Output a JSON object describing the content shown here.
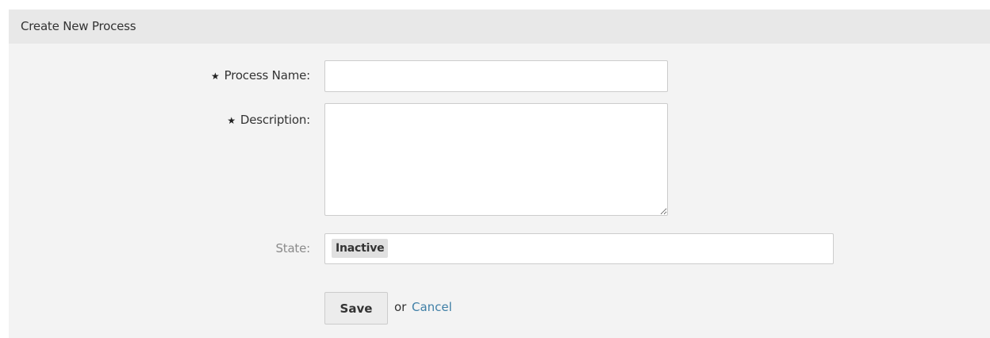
{
  "panel": {
    "title": "Create New Process"
  },
  "form": {
    "process_name": {
      "label": "Process Name:",
      "required_marker": "★",
      "value": ""
    },
    "description": {
      "label": "Description:",
      "required_marker": "★",
      "value": ""
    },
    "state": {
      "label": "State:",
      "selected": "Inactive"
    },
    "actions": {
      "save_label": "Save",
      "or_text": "or",
      "cancel_label": "Cancel"
    }
  },
  "colors": {
    "panel_bg": "#f3f3f3",
    "header_bg": "#e8e8e8",
    "link": "#3f7fa6"
  }
}
